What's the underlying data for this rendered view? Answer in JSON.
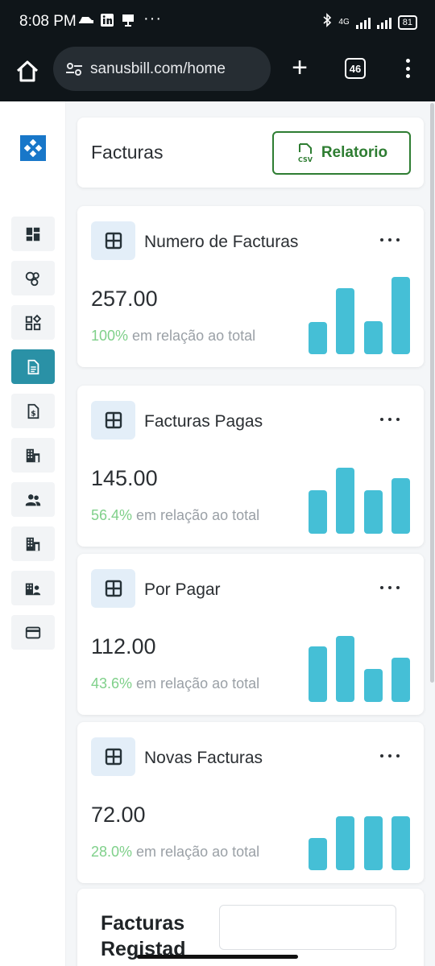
{
  "status_bar": {
    "time": "8:08 PM",
    "network": "4G",
    "battery": "81",
    "icons": [
      "car-icon",
      "linkedin-icon",
      "presentation-icon",
      "more-dots-icon",
      "bluetooth-icon",
      "signal-icon"
    ]
  },
  "browser": {
    "url": "sanusbill.com/home",
    "tab_count": "46",
    "plus": "+"
  },
  "sidebar": {
    "items": [
      {
        "icon": "dashboard-icon",
        "active": false
      },
      {
        "icon": "bubbles-icon",
        "active": false
      },
      {
        "icon": "widgets-icon",
        "active": false
      },
      {
        "icon": "document-icon",
        "active": true
      },
      {
        "icon": "invoice-dollar-icon",
        "active": false
      },
      {
        "icon": "building-icon",
        "active": false
      },
      {
        "icon": "people-icon",
        "active": false
      },
      {
        "icon": "building-icon",
        "active": false
      },
      {
        "icon": "business-people-icon",
        "active": false
      },
      {
        "icon": "credit-card-icon",
        "active": false
      }
    ]
  },
  "header": {
    "title": "Facturas",
    "report_button": "Relatorio",
    "report_icon_text": "CSV"
  },
  "stats": [
    {
      "label": "Numero de Facturas",
      "value": "257.00",
      "percent": "100%",
      "suffix": " em relação ao total",
      "bars": [
        0.42,
        0.85,
        0.43,
        1.0
      ]
    },
    {
      "label": "Facturas Pagas",
      "value": "145.00",
      "percent": "56.4%",
      "suffix": " em relação ao total",
      "bars": [
        0.66,
        1.0,
        0.66,
        0.84
      ]
    },
    {
      "label": "Por Pagar",
      "value": "112.00",
      "percent": "43.6%",
      "suffix": " em relação ao total",
      "bars": [
        0.84,
        1.0,
        0.5,
        0.67
      ]
    },
    {
      "label": "Novas Facturas",
      "value": "72.00",
      "percent": "28.0%",
      "suffix": " em relação ao total",
      "bars": [
        0.59,
        1.0,
        1.0,
        1.0
      ]
    }
  ],
  "bottom_card": {
    "title": "Facturas Registad"
  },
  "colors": {
    "accent": "#2a91a6",
    "bar": "#45bfd6",
    "positive": "#7fd08a",
    "report_green": "#2e7d32",
    "logo_blue": "#1877c9"
  }
}
